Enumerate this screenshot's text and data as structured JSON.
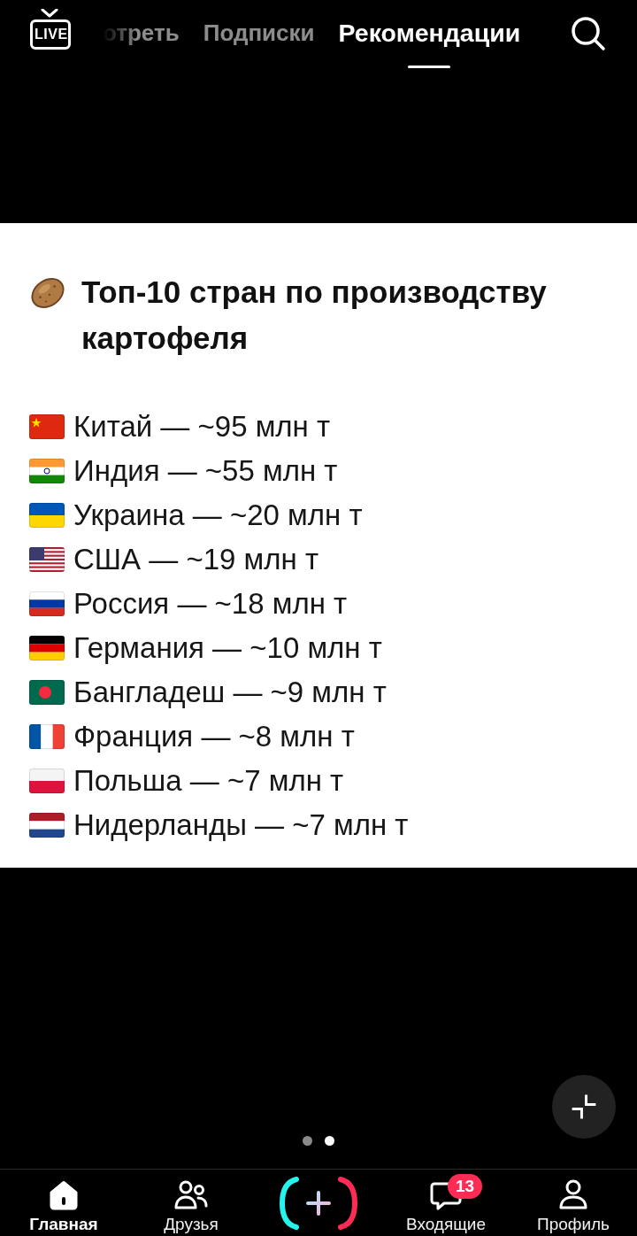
{
  "header": {
    "live_button": {
      "label": "LIVE"
    },
    "tabs": [
      {
        "label": "отреть",
        "selected": false,
        "clipped": true
      },
      {
        "label": "Подписки",
        "selected": false,
        "clipped": false
      },
      {
        "label": "Рекомендации",
        "selected": true,
        "clipped": false
      }
    ]
  },
  "post": {
    "title": "Топ-10 стран по производству картофеля",
    "items": [
      {
        "kind": "china",
        "text": "Китай — ~95 млн т"
      },
      {
        "kind": "india",
        "text": "Индия — ~55 млн т"
      },
      {
        "kind": "ukraine",
        "text": "Украина — ~20 млн т"
      },
      {
        "kind": "usa",
        "text": "США — ~19 млн т"
      },
      {
        "kind": "russia",
        "text": "Россия — ~18 млн т"
      },
      {
        "kind": "germany",
        "text": "Германия — ~10 млн т"
      },
      {
        "kind": "bangladesh",
        "text": "Бангладеш — ~9 млн т"
      },
      {
        "kind": "france",
        "text": "Франция — ~8 млн т"
      },
      {
        "kind": "poland",
        "text": "Польша — ~7 млн т"
      },
      {
        "kind": "netherlands",
        "text": "Нидерланды — ~7 млн т"
      }
    ]
  },
  "pager": {
    "dots": [
      {
        "selected": false
      },
      {
        "selected": true
      }
    ]
  },
  "bottom_nav": {
    "items": [
      {
        "kind": "home",
        "label": "Главная",
        "selected": true
      },
      {
        "kind": "friends",
        "label": "Друзья",
        "selected": false
      },
      {
        "kind": "create",
        "selected": false
      },
      {
        "kind": "inbox",
        "label": "Входящие",
        "selected": false,
        "badge": "13"
      },
      {
        "kind": "profile",
        "label": "Профиль",
        "selected": false
      }
    ]
  }
}
